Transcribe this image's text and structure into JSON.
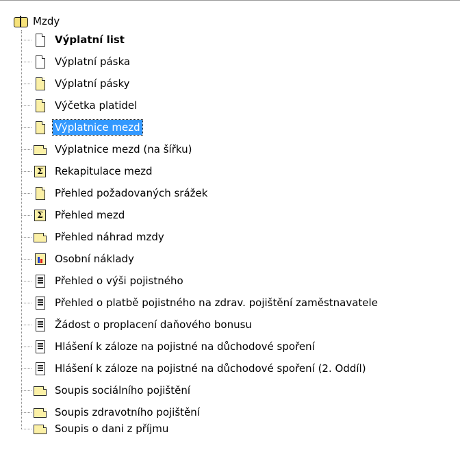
{
  "tree": {
    "root": {
      "label": "Mzdy",
      "icon": "book-icon"
    },
    "items": [
      {
        "label": "Výplatní list",
        "icon": "document-white-icon",
        "bold": true
      },
      {
        "label": "Výplatní páska",
        "icon": "document-white-icon"
      },
      {
        "label": "Výplatní pásky",
        "icon": "document-yellow-icon"
      },
      {
        "label": "Výčetka platidel",
        "icon": "document-yellow-icon"
      },
      {
        "label": "Výplatnice mezd",
        "icon": "document-yellow-icon",
        "selected": true
      },
      {
        "label": "Výplatnice mezd (na šířku)",
        "icon": "document-landscape-icon"
      },
      {
        "label": "Rekapitulace mezd",
        "icon": "sum-report-icon"
      },
      {
        "label": "Přehled požadovaných srážek",
        "icon": "document-yellow-icon"
      },
      {
        "label": "Přehled mezd",
        "icon": "sum-report-icon"
      },
      {
        "label": "Přehled náhrad mzdy",
        "icon": "document-landscape-icon"
      },
      {
        "label": "Osobní náklady",
        "icon": "chart-report-icon"
      },
      {
        "label": "Přehled o výši pojistného",
        "icon": "text-document-icon"
      },
      {
        "label": "Přehled o platbě pojistného na zdrav. pojištění zaměstnavatele",
        "icon": "text-document-icon"
      },
      {
        "label": "Žádost o proplacení daňového bonusu",
        "icon": "text-document-icon"
      },
      {
        "label": "Hlášení k záloze na pojistné na důchodové spoření",
        "icon": "text-document-icon"
      },
      {
        "label": "Hlášení k záloze na pojistné na důchodové spoření (2. Oddíl)",
        "icon": "text-document-icon"
      },
      {
        "label": "Soupis sociálního pojištění",
        "icon": "document-landscape-icon"
      },
      {
        "label": "Soupis zdravotního pojištění",
        "icon": "document-landscape-icon"
      },
      {
        "label": "Soupis o dani z příjmu",
        "icon": "document-landscape-icon"
      }
    ]
  },
  "colors": {
    "selection": "#3399ff",
    "document_yellow": "#fbf0a6"
  }
}
